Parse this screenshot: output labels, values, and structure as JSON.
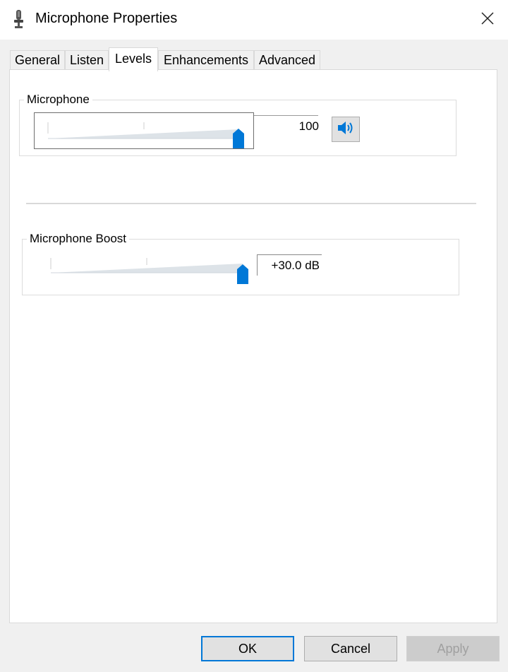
{
  "window": {
    "title": "Microphone Properties",
    "icon": "microphone-icon",
    "close_icon": "close-icon"
  },
  "tabs": [
    {
      "label": "General",
      "active": false
    },
    {
      "label": "Listen",
      "active": false
    },
    {
      "label": "Levels",
      "active": true
    },
    {
      "label": "Enhancements",
      "active": false
    },
    {
      "label": "Advanced",
      "active": false
    }
  ],
  "levels": {
    "microphone": {
      "label": "Microphone",
      "value": "100",
      "level_fraction": 1.0,
      "mute_button_icon": "speaker-icon"
    },
    "boost": {
      "label": "Microphone Boost",
      "value": "+30.0 dB",
      "level_fraction": 1.0
    }
  },
  "buttons": {
    "ok": "OK",
    "cancel": "Cancel",
    "apply": "Apply"
  },
  "colors": {
    "accent": "#0078d7",
    "thumb": "#0078d7"
  }
}
